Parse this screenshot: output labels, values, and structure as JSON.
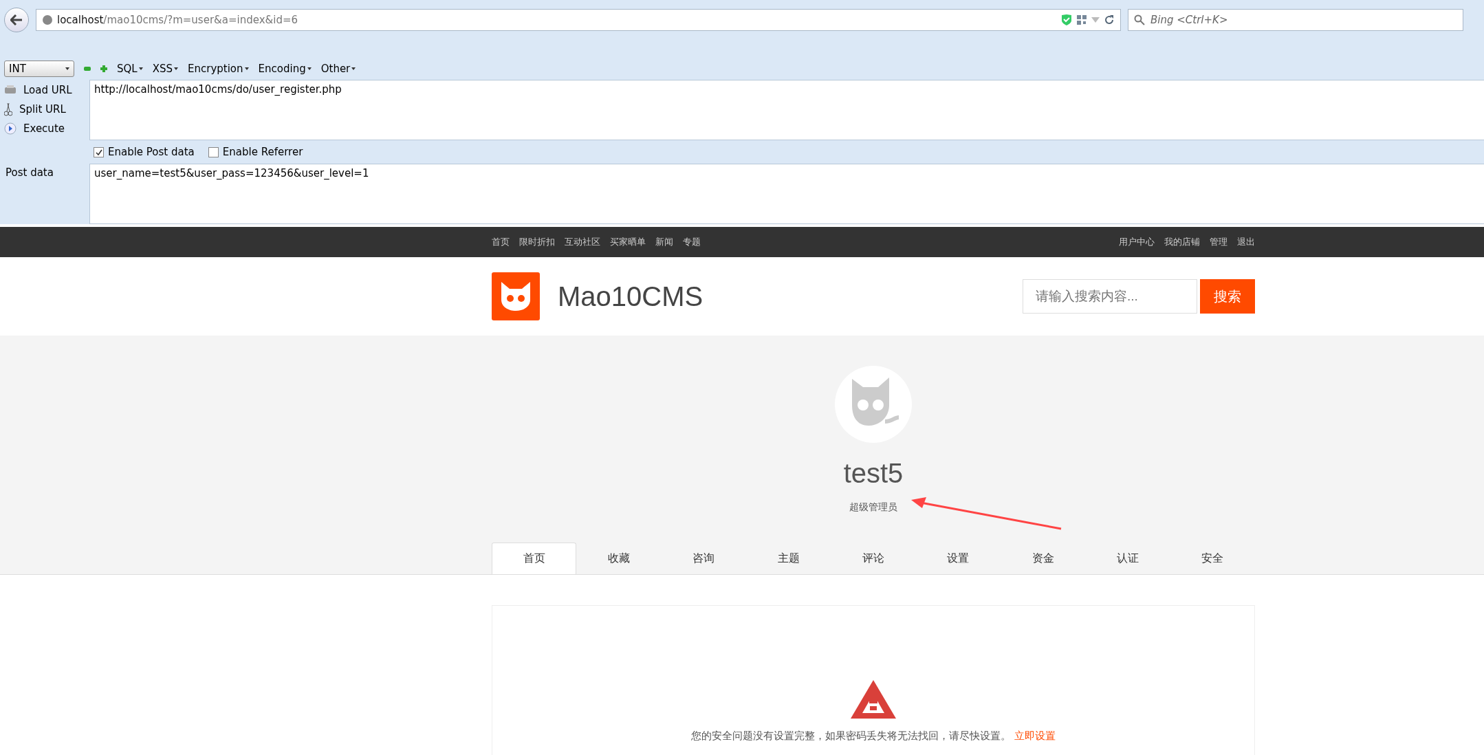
{
  "browser": {
    "address_host": "localhost",
    "address_path": "/mao10cms/?m=user&a=index&id=6",
    "search_placeholder": "Bing <Ctrl+K>"
  },
  "hackbar": {
    "type_select": "INT",
    "menus": [
      "SQL",
      "XSS",
      "Encryption",
      "Encoding",
      "Other"
    ],
    "actions": [
      {
        "kind": "load",
        "label": "Load URL"
      },
      {
        "kind": "split",
        "label": "Split URL"
      },
      {
        "kind": "execute",
        "label": "Execute"
      }
    ],
    "url": "http://localhost/mao10cms/do/user_register.php",
    "options": [
      {
        "label": "Enable Post data",
        "checked": true
      },
      {
        "label": "Enable Referrer",
        "checked": false
      }
    ],
    "post_label": "Post data",
    "post_data": "user_name=test5&user_pass=123456&user_level=1"
  },
  "site": {
    "nav_left": [
      "首页",
      "限时折扣",
      "互动社区",
      "买家晒单",
      "新闻",
      "专题"
    ],
    "nav_right": [
      "用户中心",
      "我的店铺",
      "管理",
      "退出"
    ],
    "brand": "Mao10CMS",
    "search_placeholder": "请输入搜索内容...",
    "search_button": "搜索",
    "profile": {
      "name": "test5",
      "role": "超级管理员"
    },
    "tabs": [
      {
        "label": "首页",
        "selected": true
      },
      {
        "label": "收藏",
        "selected": false
      },
      {
        "label": "咨询",
        "selected": false
      },
      {
        "label": "主题",
        "selected": false
      },
      {
        "label": "评论",
        "selected": false
      },
      {
        "label": "设置",
        "selected": false
      },
      {
        "label": "资金",
        "selected": false
      },
      {
        "label": "认证",
        "selected": false
      },
      {
        "label": "安全",
        "selected": false
      }
    ],
    "notice": {
      "text": "您的安全问题没有设置完整，如果密码丢失将无法找回，请尽快设置。",
      "link": "立即设置"
    }
  }
}
